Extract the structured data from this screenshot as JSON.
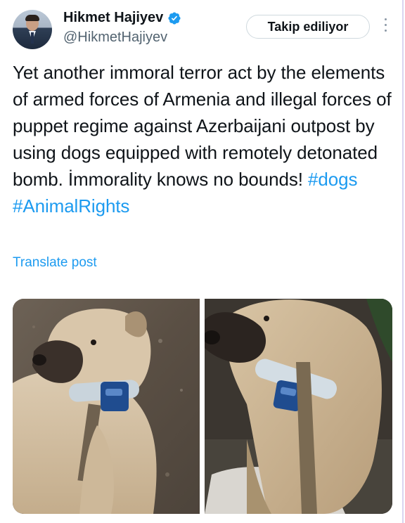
{
  "author": {
    "name": "Hikmet Hajiyev",
    "handle": "@HikmetHajiyev",
    "verified_color": "#1d9bf0",
    "avatar_icon": "avatar"
  },
  "follow_button": {
    "label": "Takip ediliyor"
  },
  "more_icon": "more-vertical-icon",
  "post": {
    "body": "Yet another immoral terror act by the elements of armed forces of Armenia and illegal forces of puppet regime against Azerbaijani outpost by using dogs equipped with remotely detonated bomb. İmmorality knows no bounds!",
    "hashtags": "#dogs #AnimalRights"
  },
  "translate_link": "Translate post",
  "colors": {
    "link": "#1d9bf0",
    "text": "#0f1419",
    "muted": "#536471"
  }
}
